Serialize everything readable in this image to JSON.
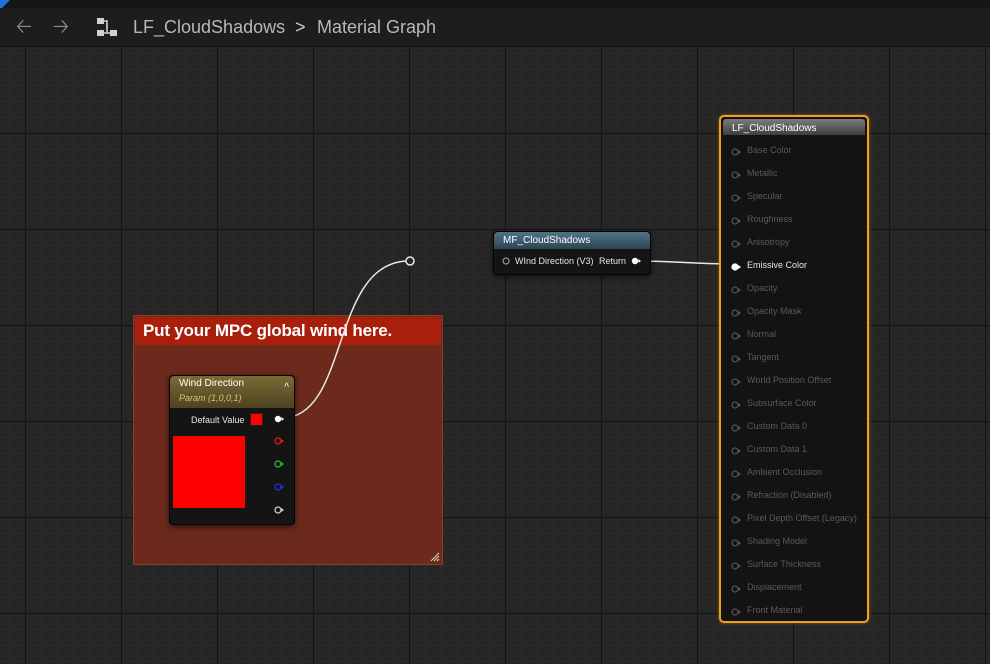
{
  "breadcrumb": {
    "asset": "LF_CloudShadows",
    "separator": ">",
    "graph": "Material Graph"
  },
  "comment": {
    "text": "Put your MPC global wind here.",
    "color": "#a8200c"
  },
  "param_node": {
    "title": "Wind Direction",
    "subtitle": "Param (1,0,0,1)",
    "default_value_label": "Default Value",
    "default_value_color": "#ff0000",
    "outputs": [
      "white",
      "red",
      "green",
      "blue",
      "alpha"
    ],
    "collapse_icon": "chevron-up-icon"
  },
  "function_node": {
    "title": "MF_CloudShadows",
    "input_label": "WInd Direction (V3)",
    "output_label": "Return"
  },
  "material_node": {
    "title": "LF_CloudShadows",
    "inputs": [
      {
        "label": "Base Color",
        "connected": false
      },
      {
        "label": "Metallic",
        "connected": false
      },
      {
        "label": "Specular",
        "connected": false
      },
      {
        "label": "Roughness",
        "connected": false
      },
      {
        "label": "Anisotropy",
        "connected": false
      },
      {
        "label": "Emissive Color",
        "connected": true
      },
      {
        "label": "Opacity",
        "connected": false
      },
      {
        "label": "Opacity Mask",
        "connected": false
      },
      {
        "label": "Normal",
        "connected": false
      },
      {
        "label": "Tangent",
        "connected": false
      },
      {
        "label": "World Position Offset",
        "connected": false
      },
      {
        "label": "Subsurface Color",
        "connected": false
      },
      {
        "label": "Custom Data 0",
        "connected": false
      },
      {
        "label": "Custom Data 1",
        "connected": false
      },
      {
        "label": "Ambient Occlusion",
        "connected": false
      },
      {
        "label": "Refraction (Disabled)",
        "connected": false
      },
      {
        "label": "Pixel Depth Offset (Legacy)",
        "connected": false
      },
      {
        "label": "Shading Model",
        "connected": false
      },
      {
        "label": "Surface Thickness",
        "connected": false
      },
      {
        "label": "Displacement",
        "connected": false
      },
      {
        "label": "Front Material",
        "connected": false
      }
    ]
  },
  "colors": {
    "selection_outline": "#f0a020",
    "canvas": "#262626"
  }
}
